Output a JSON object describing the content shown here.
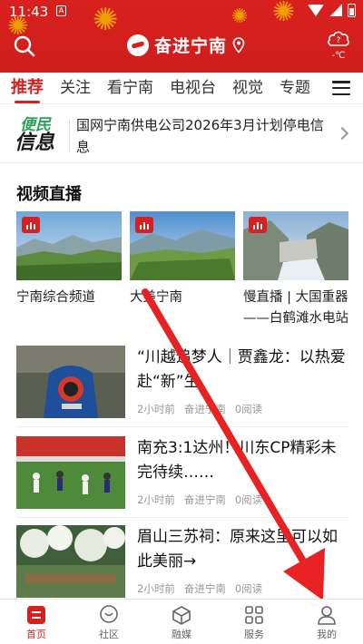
{
  "status_bar": {
    "time": "11:43",
    "sim_icon": "A"
  },
  "header": {
    "app_name": "奋进宁南",
    "weather_temp": "-℃",
    "weather_icon": "cloud-question-icon",
    "brand_color": "#d8211f"
  },
  "tabs": [
    {
      "label": "推荐",
      "active": true
    },
    {
      "label": "关注"
    },
    {
      "label": "看宁南"
    },
    {
      "label": "电视台"
    },
    {
      "label": "视觉"
    },
    {
      "label": "专题"
    }
  ],
  "notice": {
    "badge_top": "便民",
    "badge_bottom": "信息",
    "text": "国网宁南供电公司2026年3月计划停电信息"
  },
  "live_section": {
    "title": "视频直播",
    "videos": [
      {
        "title": "宁南综合频道"
      },
      {
        "title": "大美宁南"
      },
      {
        "title": "慢直播 | 大国重器——白鹤滩水电站"
      }
    ]
  },
  "news": [
    {
      "title": "“川越追梦人｜贾鑫龙：以热爱赴“新”生",
      "time": "2小时前",
      "source": "奋进宁南",
      "reads": "0阅读"
    },
    {
      "title": "南充3:1达州！川东CP精彩未完待续……",
      "time": "2小时前",
      "source": "奋进宁南",
      "reads": "0阅读"
    },
    {
      "title": "眉山三苏祠：原来这里可以如此美丽→",
      "time": "2小时前",
      "source": "奋进宁南",
      "reads": "0阅读"
    }
  ],
  "bottom_nav": [
    {
      "label": "首页",
      "icon": "home-icon",
      "active": true
    },
    {
      "label": "社区",
      "icon": "community-icon"
    },
    {
      "label": "融媒",
      "icon": "media-cube-icon"
    },
    {
      "label": "服务",
      "icon": "services-grid-icon"
    },
    {
      "label": "我的",
      "icon": "profile-icon"
    }
  ]
}
